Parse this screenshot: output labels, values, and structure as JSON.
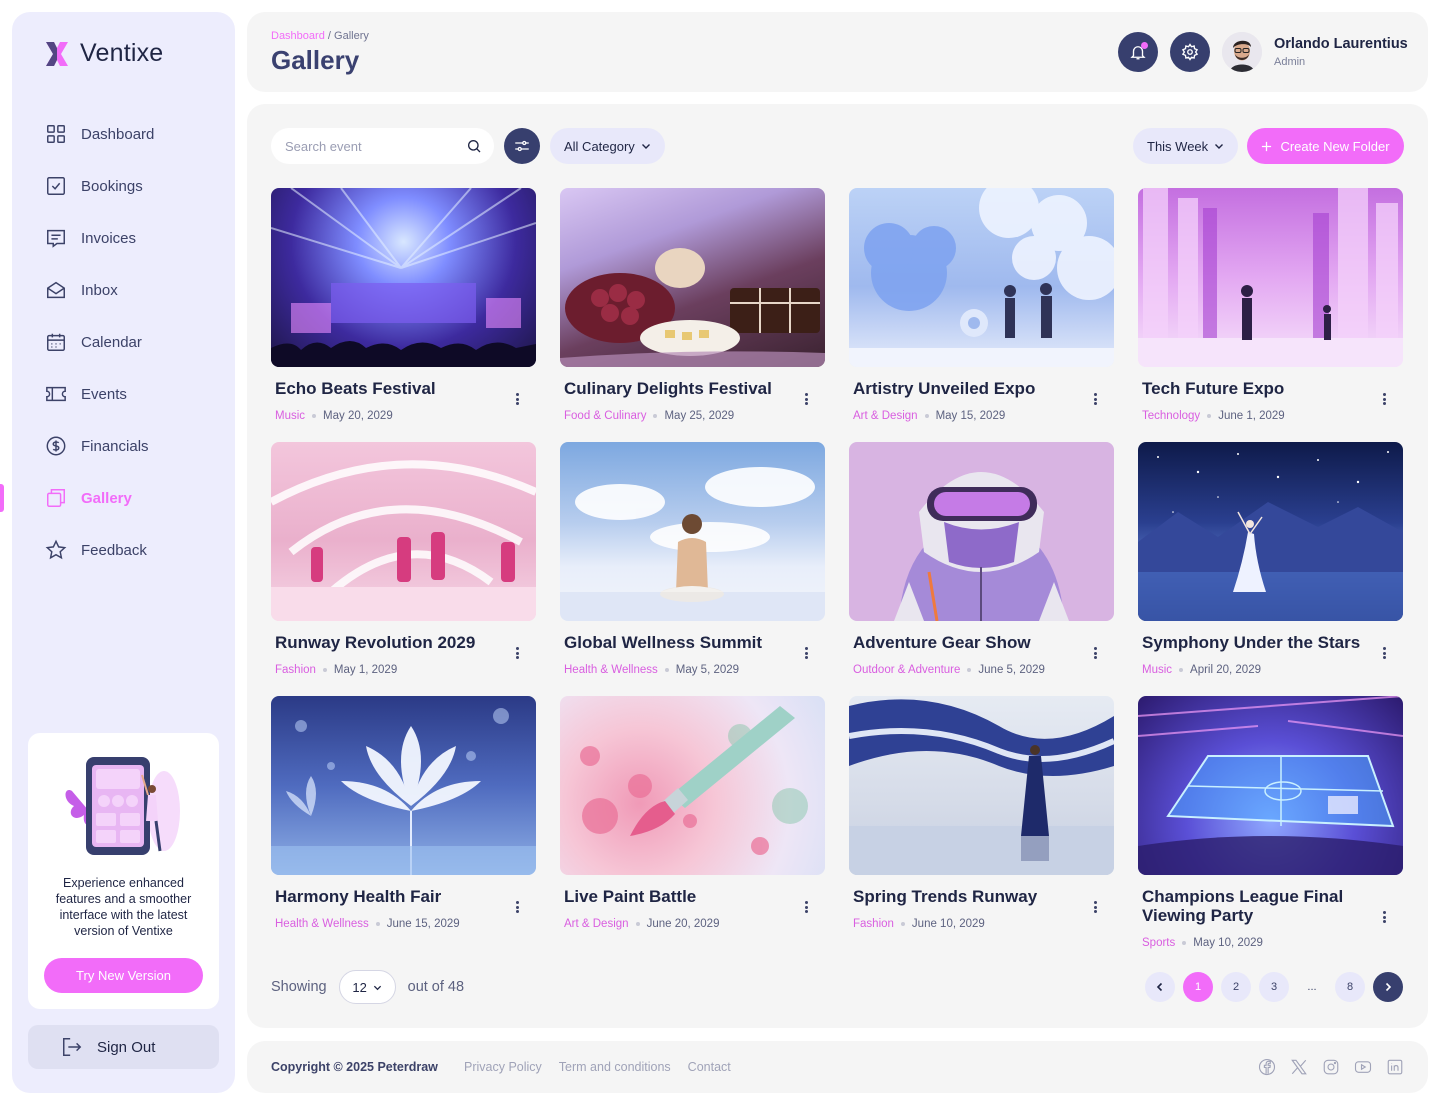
{
  "brand": {
    "name": "Ventixe",
    "accent": "#f26cf9",
    "navy": "#373f6e"
  },
  "sidebar": {
    "items": [
      {
        "label": "Dashboard",
        "icon": "grid-icon"
      },
      {
        "label": "Bookings",
        "icon": "checkbox-icon"
      },
      {
        "label": "Invoices",
        "icon": "invoice-icon"
      },
      {
        "label": "Inbox",
        "icon": "envelope-icon"
      },
      {
        "label": "Calendar",
        "icon": "calendar-icon"
      },
      {
        "label": "Events",
        "icon": "ticket-icon"
      },
      {
        "label": "Financials",
        "icon": "dollar-icon"
      },
      {
        "label": "Gallery",
        "icon": "gallery-icon",
        "active": true
      },
      {
        "label": "Feedback",
        "icon": "star-icon"
      }
    ],
    "promo": {
      "text": "Experience enhanced features and a smoother interface with the latest version of Ventixe",
      "button": "Try New Version"
    },
    "signout": "Sign Out"
  },
  "header": {
    "breadcrumb": [
      "Dashboard",
      "Gallery"
    ],
    "title": "Gallery",
    "user": {
      "name": "Orlando Laurentius",
      "role": "Admin"
    }
  },
  "toolbar": {
    "search_placeholder": "Search event",
    "category": "All Category",
    "period": "This Week",
    "create_label": "Create New Folder"
  },
  "cards": [
    {
      "title": "Echo Beats Festival",
      "category": "Music",
      "date": "May 20, 2029"
    },
    {
      "title": "Culinary Delights Festival",
      "category": "Food & Culinary",
      "date": "May 25, 2029"
    },
    {
      "title": "Artistry Unveiled Expo",
      "category": "Art & Design",
      "date": "May 15, 2029"
    },
    {
      "title": "Tech Future Expo",
      "category": "Technology",
      "date": "June 1, 2029"
    },
    {
      "title": "Runway Revolution 2029",
      "category": "Fashion",
      "date": "May 1, 2029"
    },
    {
      "title": "Global Wellness Summit",
      "category": "Health & Wellness",
      "date": "May 5, 2029"
    },
    {
      "title": "Adventure Gear Show",
      "category": "Outdoor & Adventure",
      "date": "June 5, 2029"
    },
    {
      "title": "Symphony Under the Stars",
      "category": "Music",
      "date": "April 20, 2029"
    },
    {
      "title": "Harmony Health Fair",
      "category": "Health & Wellness",
      "date": "June 15, 2029"
    },
    {
      "title": "Live Paint Battle",
      "category": "Art & Design",
      "date": "June 20, 2029"
    },
    {
      "title": "Spring Trends Runway",
      "category": "Fashion",
      "date": "June 10, 2029"
    },
    {
      "title": "Champions League Final Viewing Party",
      "category": "Sports",
      "date": "May 10, 2029"
    }
  ],
  "pagination": {
    "showing_label": "Showing",
    "page_size": "12",
    "total_label": "out of 48",
    "pages": [
      "1",
      "2",
      "3",
      "...",
      "8"
    ],
    "current": "1"
  },
  "footer": {
    "copyright": "Copyright © 2025 Peterdraw",
    "links": [
      "Privacy Policy",
      "Term and conditions",
      "Contact"
    ],
    "socials": [
      "facebook-icon",
      "x-icon",
      "instagram-icon",
      "youtube-icon",
      "linkedin-icon"
    ]
  }
}
